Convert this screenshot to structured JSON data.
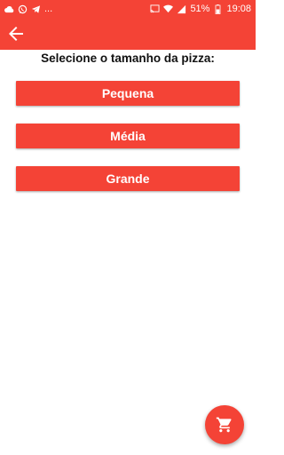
{
  "status_bar": {
    "icons_left": [
      "cloud-icon",
      "whatsapp-icon",
      "telegram-icon"
    ],
    "dots": "...",
    "icons_right": [
      "cast-icon",
      "wifi-icon",
      "signal-icon"
    ],
    "battery": "51%",
    "battery_icon": "battery-icon",
    "time": "19:08"
  },
  "app_bar": {
    "back_icon": "arrow-back-icon"
  },
  "main": {
    "prompt": "Selecione o tamanho da pizza:",
    "sizes": [
      {
        "label": "Pequena"
      },
      {
        "label": "Média"
      },
      {
        "label": "Grande"
      }
    ]
  },
  "fab": {
    "icon": "shopping-cart-icon"
  },
  "colors": {
    "primary": "#f44336",
    "text": "#111111",
    "on_primary": "#ffffff"
  }
}
